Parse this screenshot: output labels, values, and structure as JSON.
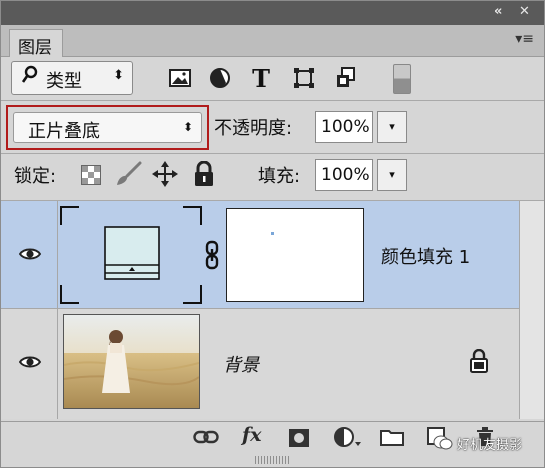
{
  "titlebar": {
    "collapse_label": "«",
    "close_label": "✕"
  },
  "tabs": [
    {
      "label": "图层"
    }
  ],
  "panel_menu_label": "▾≡",
  "filter": {
    "kind_value": "类型",
    "arrow": "⬍",
    "icons": [
      "pixel-filter-icon",
      "adjustment-filter-icon",
      "type-filter-icon",
      "shape-filter-icon",
      "smart-object-filter-icon"
    ],
    "type_glyph": "T"
  },
  "blend": {
    "mode_value": "正片叠底",
    "arrow": "⬍"
  },
  "opacity": {
    "label": "不透明度:",
    "value": "100%",
    "dropdown": "▾"
  },
  "lock": {
    "label": "锁定:"
  },
  "fill": {
    "label": "填充:",
    "value": "100%",
    "dropdown": "▾"
  },
  "layers": [
    {
      "name": "颜色填充 1",
      "selected": true,
      "kind": "fill"
    },
    {
      "name": "背景",
      "selected": false,
      "kind": "background",
      "locked": true
    }
  ],
  "bottom_bar": {
    "fx_label": "fx"
  },
  "watermark": {
    "text": "好机友摄影"
  },
  "colors": {
    "selection": "#b9cde9",
    "highlight_border": "#b11b1b"
  }
}
